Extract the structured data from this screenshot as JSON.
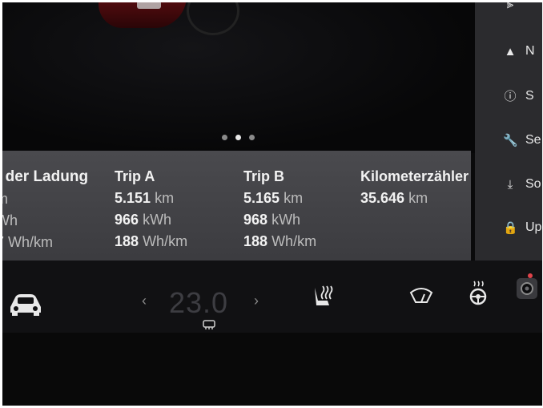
{
  "carousel": {
    "dot_count": 3,
    "active_index": 1
  },
  "trip_panel": {
    "columns": [
      {
        "title": "t der Ladung",
        "rows": [
          {
            "value": "",
            "unit": "m"
          },
          {
            "value": "",
            "unit": "Wh"
          },
          {
            "value": "7",
            "unit": "Wh/km"
          }
        ]
      },
      {
        "title": "Trip A",
        "rows": [
          {
            "value": "5.151",
            "unit": "km"
          },
          {
            "value": "966",
            "unit": "kWh"
          },
          {
            "value": "188",
            "unit": "Wh/km"
          }
        ]
      },
      {
        "title": "Trip B",
        "rows": [
          {
            "value": "5.165",
            "unit": "km"
          },
          {
            "value": "968",
            "unit": "kWh"
          },
          {
            "value": "188",
            "unit": "Wh/km"
          }
        ]
      },
      {
        "title": "Kilometerzähler",
        "rows": [
          {
            "value": "35.646",
            "unit": "km"
          }
        ]
      }
    ]
  },
  "sidebar": {
    "items": [
      {
        "icon": "lock-icon",
        "label": "Up"
      },
      {
        "icon": "download-icon",
        "label": "So"
      },
      {
        "icon": "wrench-icon",
        "label": "Se"
      },
      {
        "icon": "alert-icon",
        "label": "S"
      },
      {
        "icon": "navigation-arrow-icon",
        "label": "N"
      },
      {
        "icon": "seat-adjust-icon",
        "label": ""
      }
    ]
  },
  "climate": {
    "temperature": "23.0",
    "left_chevron": "‹",
    "right_chevron": "›"
  },
  "bottom_icons": [
    "car-icon",
    "seat-heater-icon",
    "wiper-icon",
    "steering-wheel-heater-icon",
    "camera-icon",
    "rear-defrost-icon"
  ]
}
